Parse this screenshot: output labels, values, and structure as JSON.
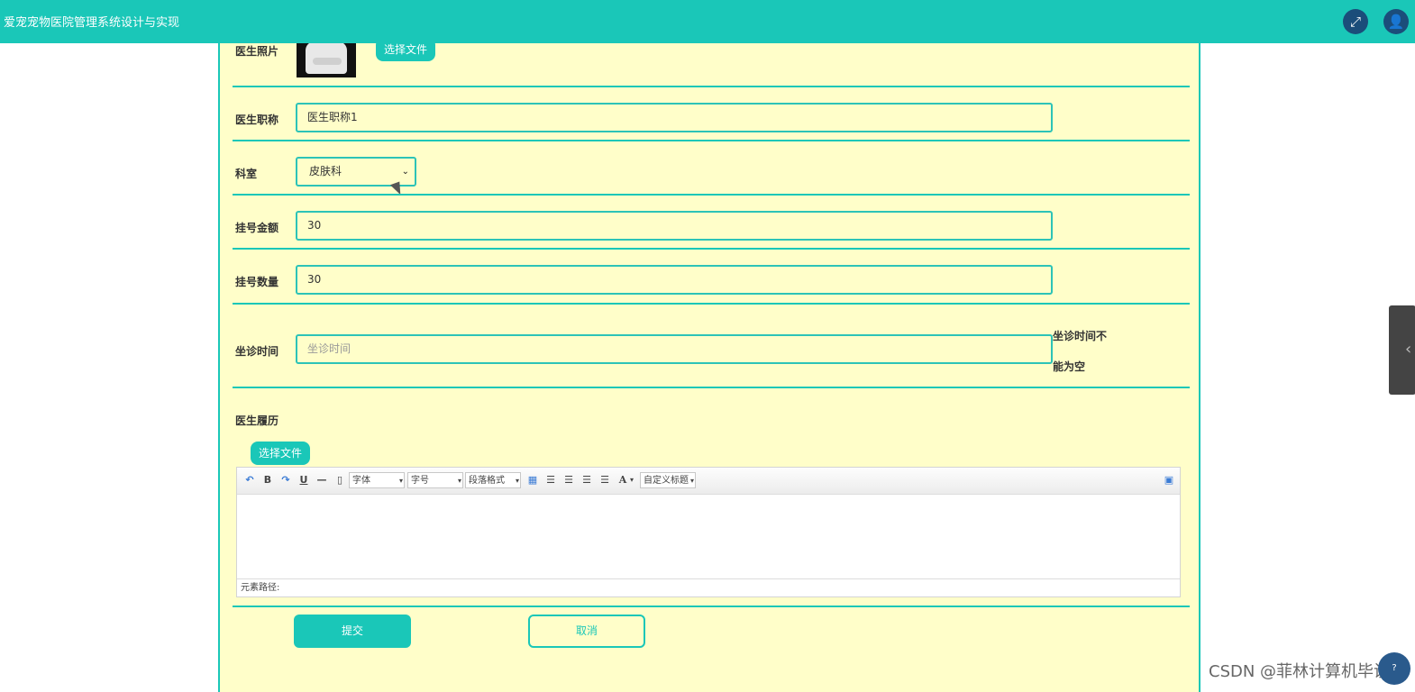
{
  "header": {
    "app_title": "爱宠宠物医院管理系统设计与实现",
    "icons": [
      "fullscreen-icon",
      "user-icon"
    ],
    "accent_color": "#1ac7b8"
  },
  "form": {
    "photo": {
      "label": "医生照片",
      "button": "选择文件"
    },
    "title": {
      "label": "医生职称",
      "value": "医生职称1"
    },
    "department": {
      "label": "科室",
      "selected": "皮肤科"
    },
    "fee": {
      "label": "挂号金额",
      "value": "30"
    },
    "quota": {
      "label": "挂号数量",
      "value": "30"
    },
    "schedule": {
      "label": "坐诊时间",
      "placeholder": "坐诊时间",
      "error_line1": "坐诊时间不",
      "error_line2": "能为空"
    },
    "resume": {
      "label": "医生履历",
      "button": "选择文件",
      "toolbar": {
        "font_family": "字体",
        "font_size": "字号",
        "paragraph": "段落格式",
        "custom_title": "自定义标题",
        "text_color_glyph": "A"
      },
      "path_label": "元素路径:"
    },
    "submit_label": "提交",
    "cancel_label": "取消"
  },
  "watermark": "CSDN @菲林计算机毕设"
}
